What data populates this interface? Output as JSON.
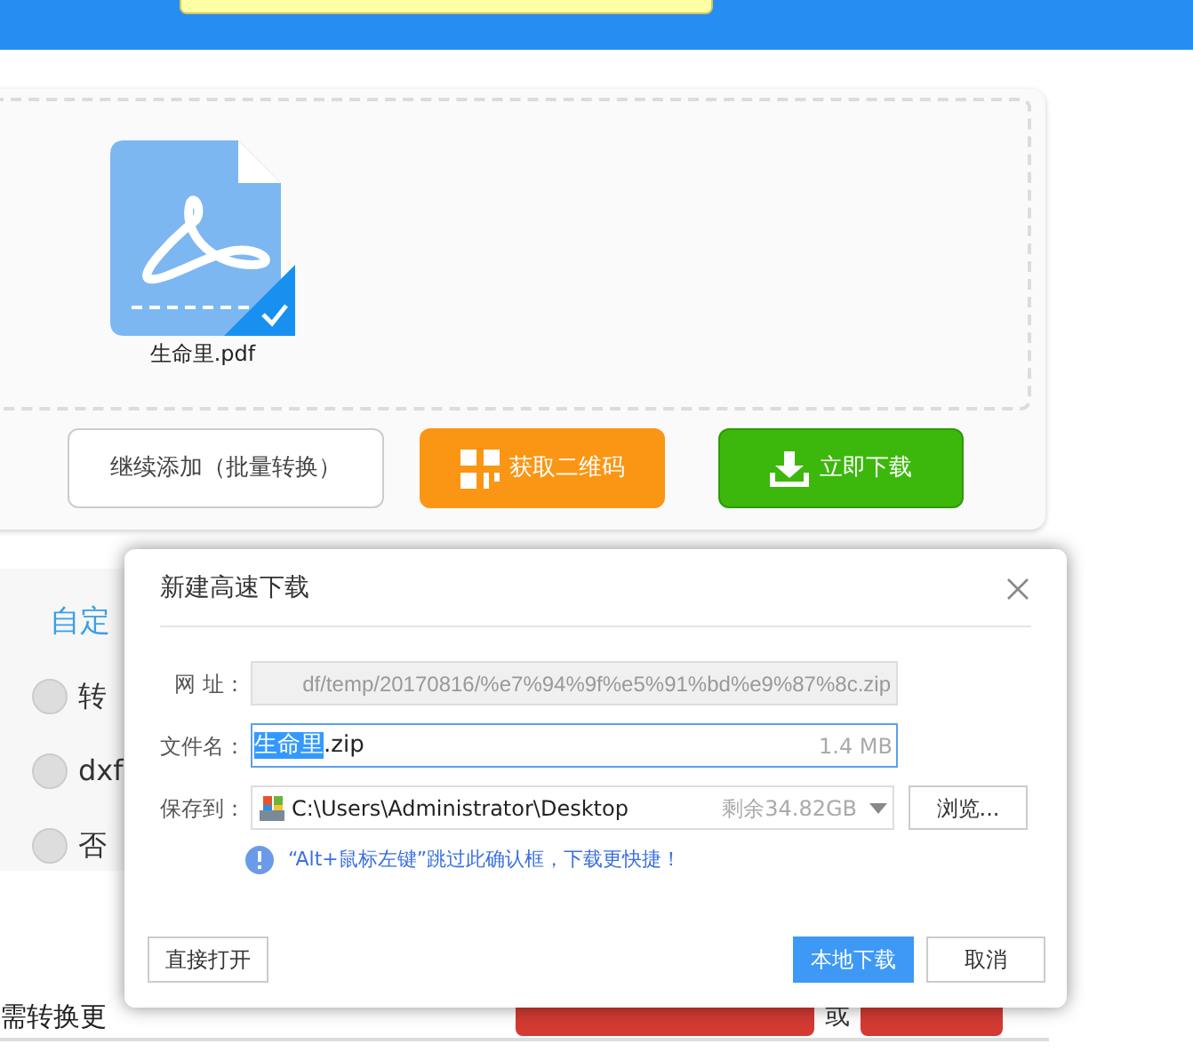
{
  "top_bar": {
    "search_field": {
      "kind": "input"
    }
  },
  "upload_panel": {
    "files": [
      {
        "name": "生命里.pdf",
        "selected": true
      }
    ],
    "buttons": [
      {
        "kind": "outline",
        "label": "继续添加（批量转换）"
      },
      {
        "kind": "qr",
        "label": "获取二维码"
      },
      {
        "kind": "download",
        "label": "立即下载"
      }
    ]
  },
  "options_panel": {
    "heading": "自定",
    "options": [
      {
        "label": "转",
        "selected": false
      },
      {
        "label": "dxf",
        "selected": false
      },
      {
        "label": "否",
        "selected": false
      }
    ]
  },
  "promo_row": {
    "text": "需转换更",
    "separator": "或"
  },
  "dialog": {
    "title": "新建高速下载",
    "url_label": "网 址：",
    "url": "df/temp/20170816/%e7%94%9f%e5%91%bd%e9%87%8c.zip",
    "name_label": "文件名：",
    "name_parts": [
      {
        "text": "生命里",
        "selected": true
      },
      {
        "text": ".zip",
        "selected": false
      }
    ],
    "size": "1.4 MB",
    "save_label": "保存到：",
    "path": "C:\\Users\\Administrator\\Desktop",
    "free_space": "剩余34.82GB",
    "browse": "浏览...",
    "tip": "“Alt+鼠标左键”跳过此确认框，下载更快捷！",
    "open_button": "直接打开",
    "download_button": "本地下载",
    "cancel_button": "取消"
  }
}
